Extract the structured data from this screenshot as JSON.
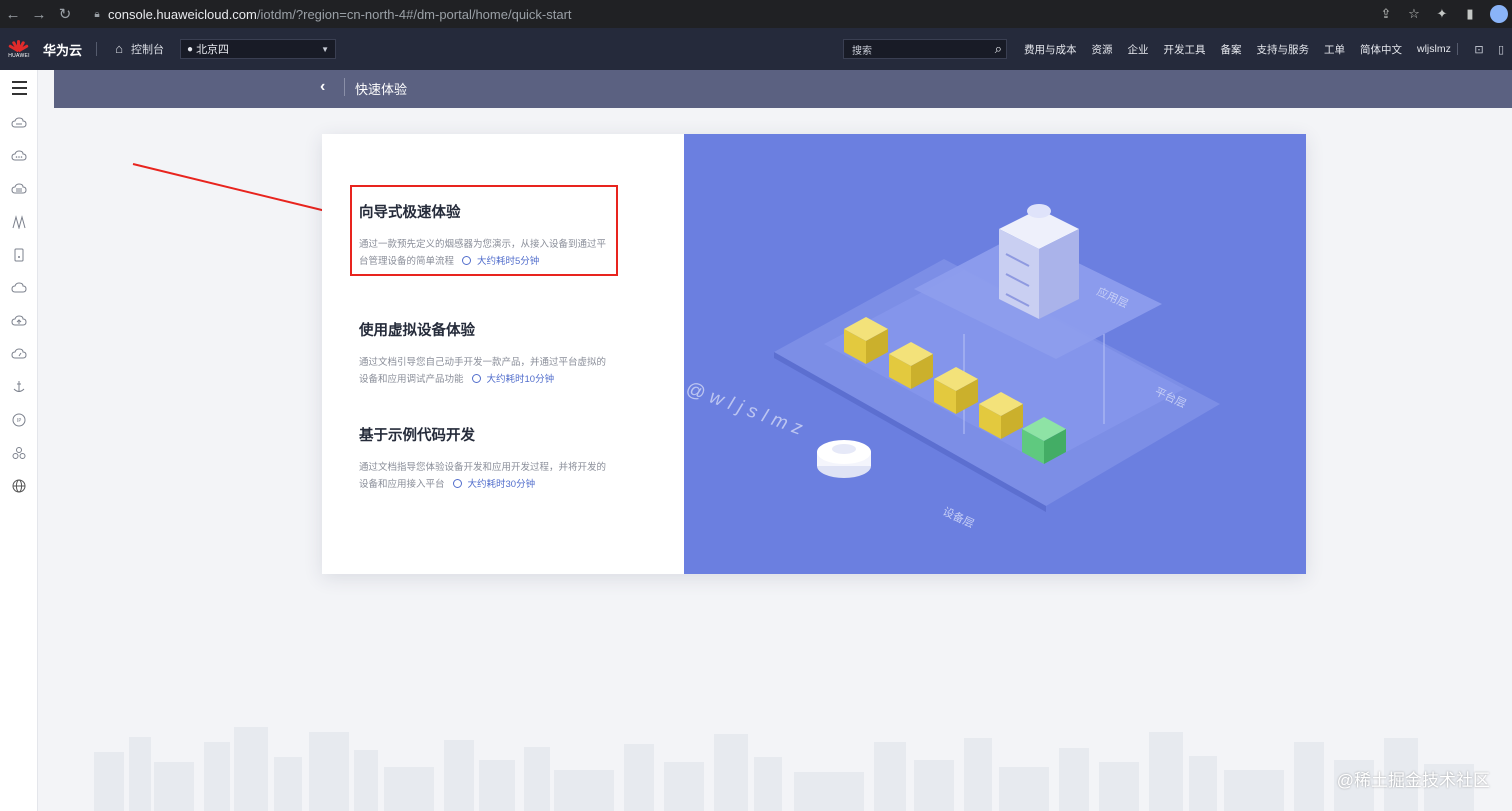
{
  "browser": {
    "url_host": "console.huaweicloud.com",
    "url_path": "/iotdm/?region=cn-north-4#/dm-portal/home/quick-start"
  },
  "topbar": {
    "logo_text": "HUAWEI",
    "brand": "华为云",
    "console_label": "控制台",
    "region": "北京四",
    "search_placeholder": "搜索",
    "menu": [
      "费用与成本",
      "资源",
      "企业",
      "开发工具",
      "备案",
      "支持与服务",
      "工单",
      "简体中文",
      "wljslmz"
    ]
  },
  "page": {
    "title": "快速体验"
  },
  "options": [
    {
      "title": "向导式极速体验",
      "desc": "通过一款预先定义的烟感器为您演示，从接入设备到通过平台管理设备的简单流程",
      "time": "大约耗时5分钟"
    },
    {
      "title": "使用虚拟设备体验",
      "desc": "通过文档引导您自己动手开发一款产品，并通过平台虚拟的设备和应用调试产品功能",
      "time": "大约耗时10分钟"
    },
    {
      "title": "基于示例代码开发",
      "desc": "通过文档指导您体验设备开发和应用开发过程，并将开发的设备和应用接入平台",
      "time": "大约耗时30分钟"
    }
  ],
  "illustration": {
    "layer_app": "应用层",
    "layer_platform": "平台层",
    "layer_device": "设备层",
    "watermark": "@wljslmz"
  },
  "corner_watermark": "@稀土掘金技术社区",
  "colors": {
    "topbar": "#252a3b",
    "header": "#5b6181",
    "illustration_bg": "#6b7fe0",
    "accent": "#526ecc",
    "highlight": "#e8241e"
  }
}
